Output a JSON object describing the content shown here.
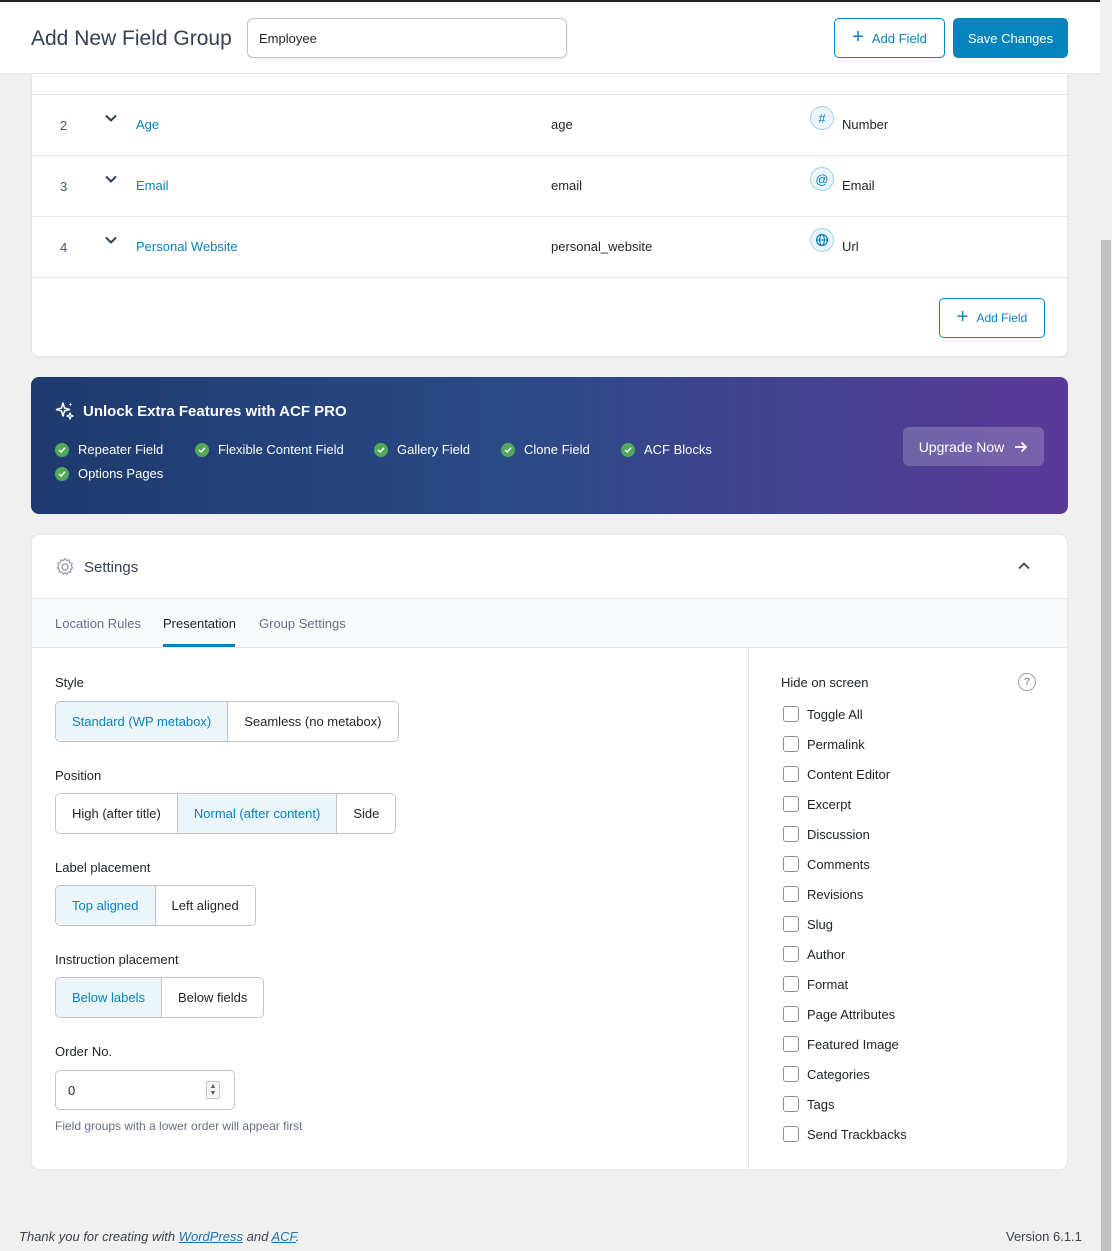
{
  "header": {
    "title": "Add New Field Group",
    "group_title_value": "Employee",
    "add_field_label": "Add Field",
    "save_label": "Save Changes"
  },
  "fields": [
    {
      "order": "2",
      "label": "Age",
      "name": "age",
      "type": "Number",
      "type_icon": "number-icon"
    },
    {
      "order": "3",
      "label": "Email",
      "name": "email",
      "type": "Email",
      "type_icon": "email-icon"
    },
    {
      "order": "4",
      "label": "Personal Website",
      "name": "personal_website",
      "type": "Url",
      "type_icon": "url-icon"
    }
  ],
  "fields_footer": {
    "add_field_label": "Add Field"
  },
  "pro_banner": {
    "title": "Unlock Extra Features with ACF PRO",
    "features": [
      "Repeater Field",
      "Flexible Content Field",
      "Gallery Field",
      "Clone Field",
      "ACF Blocks",
      "Options Pages"
    ],
    "button_label": "Upgrade Now"
  },
  "settings": {
    "title": "Settings",
    "tabs": [
      "Location Rules",
      "Presentation",
      "Group Settings"
    ],
    "active_tab": "Presentation",
    "style": {
      "label": "Style",
      "options": [
        "Standard (WP metabox)",
        "Seamless (no metabox)"
      ],
      "selected": "Standard (WP metabox)"
    },
    "position": {
      "label": "Position",
      "options": [
        "High (after title)",
        "Normal (after content)",
        "Side"
      ],
      "selected": "Normal (after content)"
    },
    "label_placement": {
      "label": "Label placement",
      "options": [
        "Top aligned",
        "Left aligned"
      ],
      "selected": "Top aligned"
    },
    "instruction_placement": {
      "label": "Instruction placement",
      "options": [
        "Below labels",
        "Below fields"
      ],
      "selected": "Below labels"
    },
    "order": {
      "label": "Order No.",
      "value": "0",
      "help": "Field groups with a lower order will appear first"
    },
    "hide_on_screen": {
      "label": "Hide on screen",
      "items": [
        "Toggle All",
        "Permalink",
        "Content Editor",
        "Excerpt",
        "Discussion",
        "Comments",
        "Revisions",
        "Slug",
        "Author",
        "Format",
        "Page Attributes",
        "Featured Image",
        "Categories",
        "Tags",
        "Send Trackbacks"
      ]
    }
  },
  "footer": {
    "thanks_prefix": "Thank you for creating with",
    "wordpress": "WordPress",
    "and": "and",
    "acf": "ACF",
    "period": ".",
    "version": "Version 6.1.1"
  },
  "colors": {
    "accent": "#0783be",
    "success": "#52aa59"
  }
}
